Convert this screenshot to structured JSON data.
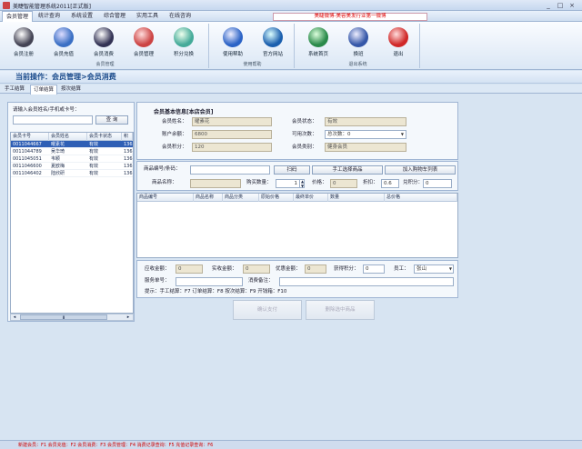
{
  "window": {
    "title": "美睫智能管理系统2011[正式版]",
    "minimize": "_",
    "maximize": "□",
    "close": "×"
  },
  "menubar": {
    "items": [
      "会员管理",
      "统计查询",
      "系统设置",
      "综合管理",
      "实用工具",
      "在线咨询"
    ],
    "marquee": "美睫微博-美容美发行业第一微博"
  },
  "ribbon": {
    "groups": [
      {
        "label": "会员管理",
        "buttons": [
          "会员注册",
          "会员充值",
          "会员消费",
          "会员管理",
          "积分兑换"
        ]
      },
      {
        "label": "使用帮助",
        "buttons": [
          "使用帮助",
          "官方网站"
        ]
      },
      {
        "label": "退出系统",
        "buttons": [
          "系统首页",
          "换班",
          "退出"
        ]
      }
    ]
  },
  "breadcrumb": "当前操作：会员管理>会员消费",
  "tabs": [
    "手工结算",
    "订单结算",
    "按次结算"
  ],
  "left": {
    "search_label": "请输入会员姓名/手机或卡号：",
    "search_value": "",
    "search_button": "查 询",
    "columns": [
      "会员卡号",
      "会员姓名",
      "会员卡状态",
      "积"
    ],
    "rows": [
      [
        "0011044667",
        "曜素花",
        "有效",
        "136"
      ],
      [
        "0011044789",
        "吴华琦",
        "有效",
        "136"
      ],
      [
        "0011045051",
        "韦颖",
        "有效",
        "136"
      ],
      [
        "0011046600",
        "夏欧梅",
        "有效",
        "136"
      ],
      [
        "0011046402",
        "陆欣研",
        "有效",
        "136"
      ]
    ],
    "hscroll": "Ⅲ"
  },
  "member_info": {
    "title": "会员基本信息[本店会员]",
    "name_label": "会员姓名：",
    "name": "曜素花",
    "status_label": "会员状态：",
    "status": "有效",
    "balance_label": "账户余额：",
    "balance": "6800",
    "times_label": "可用次数：",
    "times_value": "总次数：0",
    "points_label": "会员积分：",
    "points": "120",
    "type_label": "会员类别：",
    "type": "健身会员"
  },
  "product": {
    "code_label": "商品编号/条码：",
    "code_value": "",
    "scan_button": "扫码",
    "manual_button": "手工选择商品",
    "add_button": "加入购物车列表",
    "name_label": "商品名称：",
    "name_value": "",
    "qty_label": "购买数量：",
    "qty_value": "1",
    "price_label": "价格：",
    "price_value": "0",
    "discount_label": "折扣：",
    "discount_value": "0.6",
    "points_label": "兑积分：",
    "points_value": "0"
  },
  "cart": {
    "columns": [
      "商品编号",
      "商品名称",
      "商品分类",
      "原始价格",
      "最终单价",
      "数量",
      "总价格"
    ]
  },
  "settle": {
    "due_label": "应收金额：",
    "due": "0",
    "paid_label": "实收金额：",
    "paid": "0",
    "promo_label": "优惠金额：",
    "promo": "0",
    "earned_label": "获得积分：",
    "earned": "0",
    "staff_label": "员工：",
    "staff": "张山",
    "service_label": "服务单号：",
    "service": "",
    "note_label": "消费备注：",
    "note": "",
    "hint": "提示：手工结算：F7   订单结算：F8   按次结算：F9   开钱箱：F10"
  },
  "actions": {
    "confirm": "确认支付",
    "delete": "删除选中商品"
  },
  "statusbar": "新建会员：F1   会员充值：F2   会员消费：F3   会员管理：F4   消费记录查询：F5   充值记录查询：F6",
  "colors": {
    "accent": "#1c4c8c",
    "status_text": "#d00000",
    "selected_row": "#2f5fb5"
  }
}
